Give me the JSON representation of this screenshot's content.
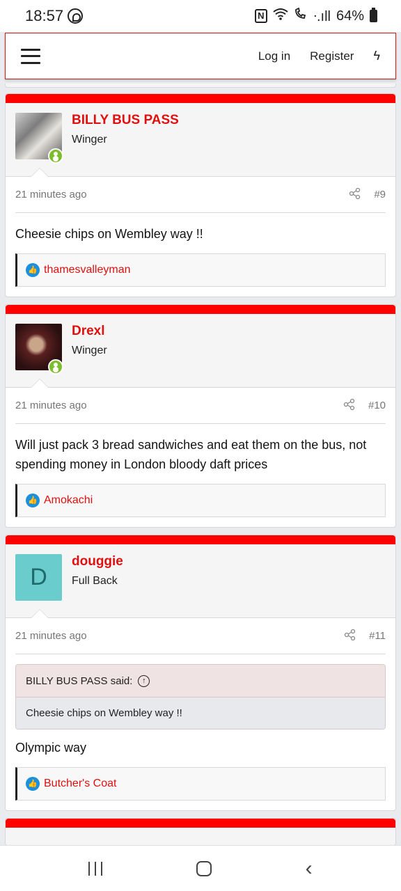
{
  "status_bar": {
    "time": "18:57",
    "nfc": "N",
    "signal": "ᐧ.ıll",
    "battery": "64%"
  },
  "header": {
    "login": "Log in",
    "register": "Register",
    "bolt": "ϟ"
  },
  "posts": [
    {
      "username": "BILLY BUS PASS",
      "user_title": "Winger",
      "time": "21 minutes ago",
      "number": "#9",
      "body": "Cheesie chips on Wembley way !!",
      "liked_by": "thamesvalleyman"
    },
    {
      "username": "Drexl",
      "user_title": "Winger",
      "time": "21 minutes ago",
      "number": "#10",
      "body": "Will just pack 3 bread sandwiches and eat them on the bus, not spending money in London bloody daft prices",
      "liked_by": "Amokachi"
    },
    {
      "username": "douggie",
      "avatar_letter": "D",
      "user_title": "Full Back",
      "time": "21 minutes ago",
      "number": "#11",
      "quote_author": "BILLY BUS PASS said:",
      "quote_text": "Cheesie chips on Wembley way !!",
      "body": "Olympic way",
      "liked_by": "Butcher's Coat"
    }
  ],
  "colors": {
    "accent_red": "#ff0000",
    "username_red": "#e01010",
    "like_blue": "#1c8fdd",
    "online_green": "#7cbd2b"
  }
}
